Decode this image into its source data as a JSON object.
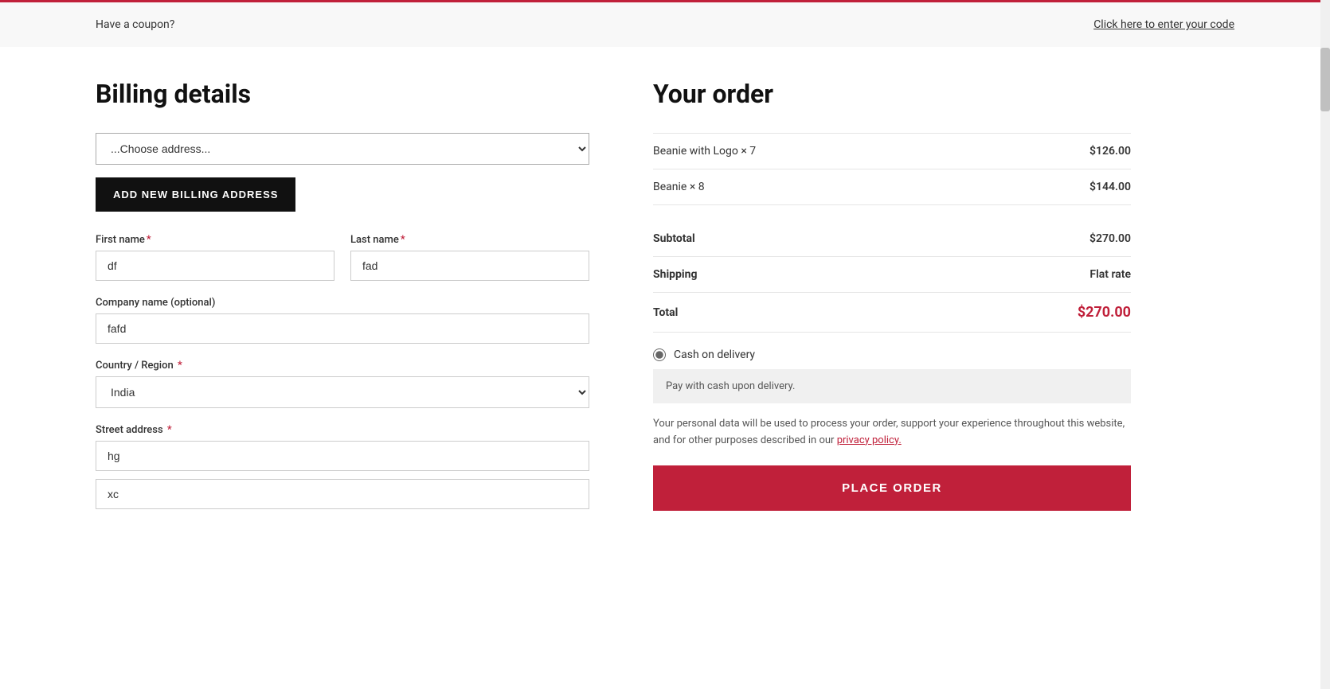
{
  "coupon": {
    "text": "Have a coupon?",
    "link_text": "Click here to enter your code"
  },
  "billing": {
    "title": "Billing details",
    "address_select": {
      "placeholder": "...Choose address...",
      "options": [
        "...Choose address..."
      ]
    },
    "add_billing_btn": "ADD NEW BILLING ADDRESS",
    "first_name_label": "First name",
    "first_name_required": "*",
    "first_name_value": "df",
    "last_name_label": "Last name",
    "last_name_required": "*",
    "last_name_value": "fad",
    "company_label": "Company name (optional)",
    "company_value": "fafd",
    "country_label": "Country / Region",
    "country_required": "*",
    "country_value": "India",
    "street_label": "Street address",
    "street_required": "*",
    "street_value1": "hg",
    "street_value2": "xc"
  },
  "order": {
    "title": "Your order",
    "items": [
      {
        "name": "Beanie with Logo",
        "quantity": "× 7",
        "price": "$126.00"
      },
      {
        "name": "Beanie",
        "quantity": "× 8",
        "price": "$144.00"
      }
    ],
    "subtotal_label": "Subtotal",
    "subtotal_value": "$270.00",
    "shipping_label": "Shipping",
    "shipping_value": "Flat rate",
    "total_label": "Total",
    "total_value": "$270.00",
    "payment_method_label": "Cash on delivery",
    "payment_description": "Pay with cash upon delivery.",
    "privacy_text": "Your personal data will be used to process your order, support your experience throughout this website, and for other purposes described in our",
    "privacy_link": "privacy policy.",
    "place_order_btn": "PLACE ORDER"
  }
}
